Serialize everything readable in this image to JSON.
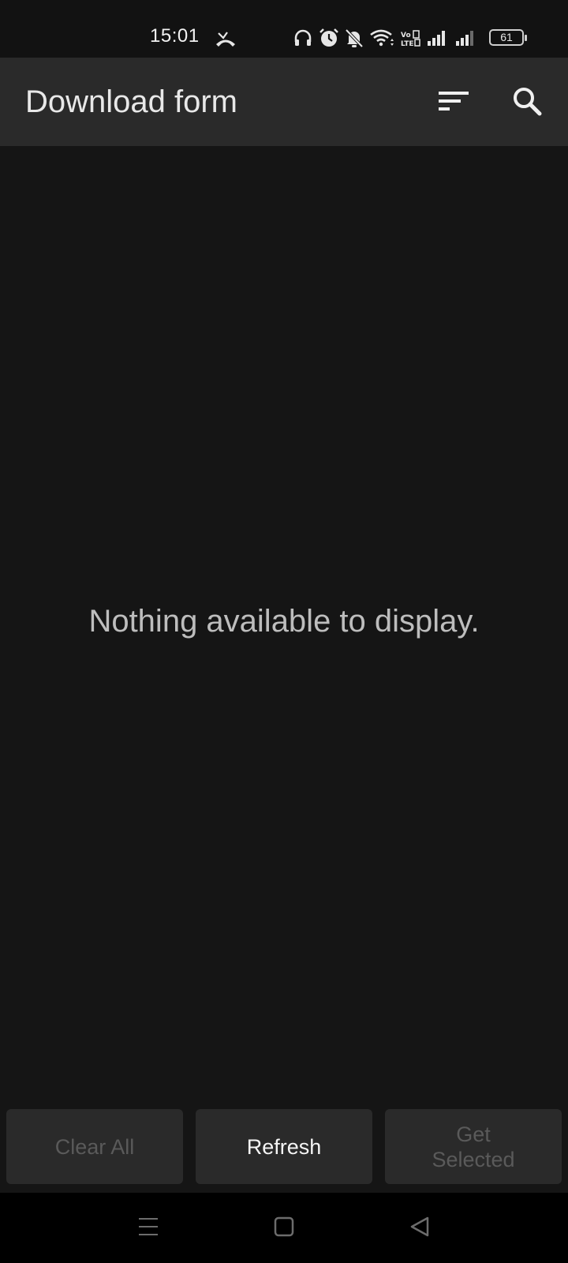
{
  "status_bar": {
    "time": "15:01",
    "battery_level": "61",
    "icons": [
      "missed-call-icon",
      "headphones-icon",
      "alarm-icon",
      "notifications-off-icon",
      "wifi-icon",
      "volte-icon",
      "signal-icon",
      "signal-icon"
    ]
  },
  "app_bar": {
    "title": "Download form",
    "actions": [
      "sort-icon",
      "search-icon"
    ]
  },
  "content": {
    "empty_message": "Nothing available to display."
  },
  "buttons": {
    "clear_all": "Clear All",
    "refresh": "Refresh",
    "get_selected": "Get Selected"
  },
  "nav_bar": {
    "icons": [
      "recents-menu-icon",
      "home-icon",
      "back-icon"
    ]
  },
  "colors": {
    "background": "#151515",
    "app_bar": "#2a2a2a",
    "disabled_text": "#5a5a5a"
  }
}
